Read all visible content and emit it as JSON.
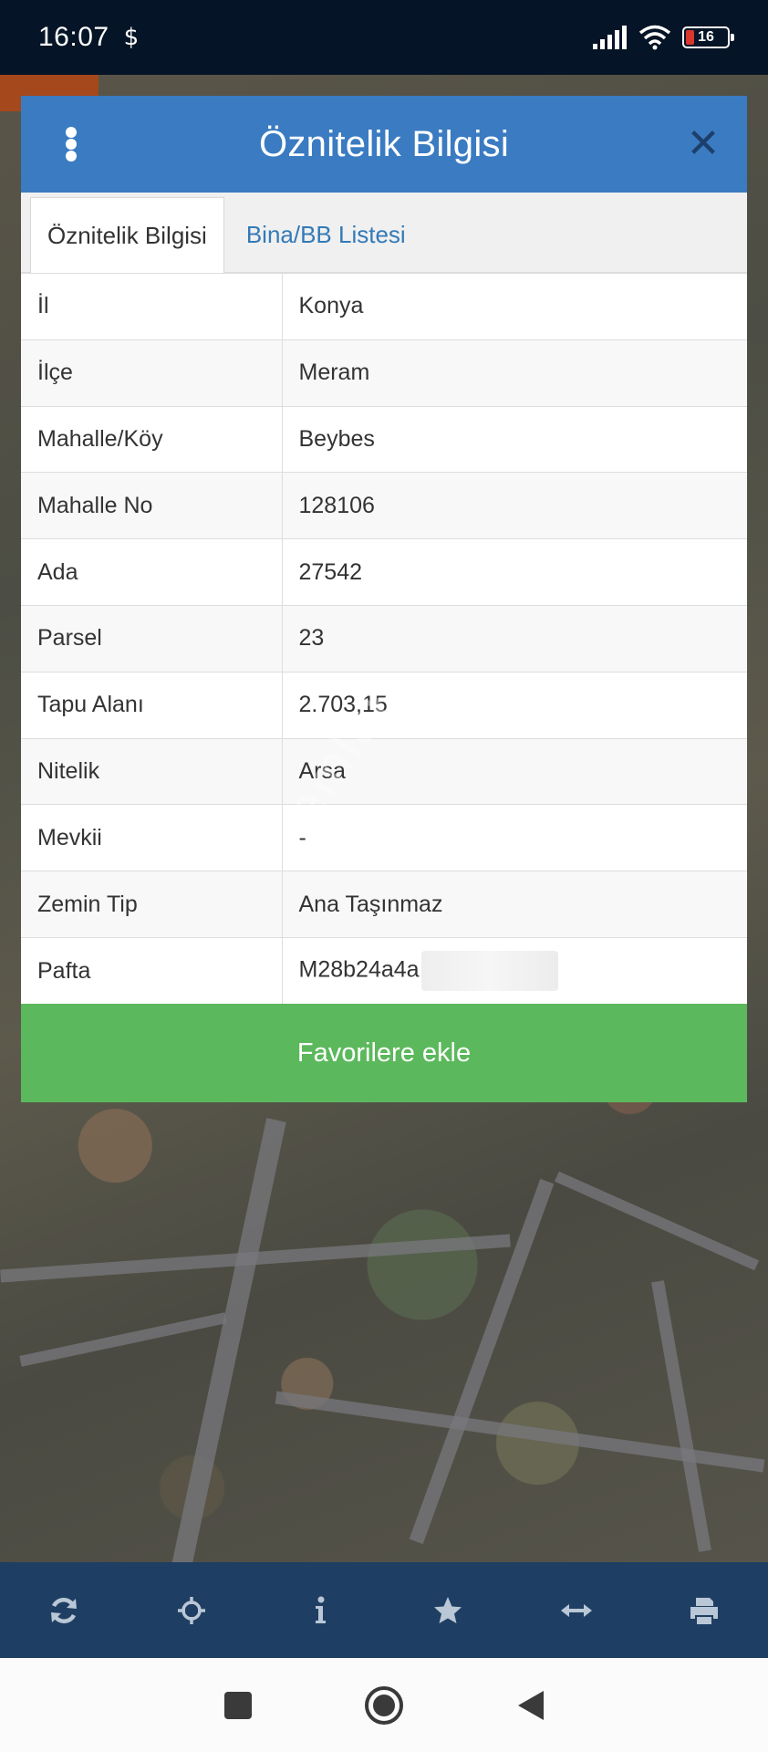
{
  "status_bar": {
    "time": "16:07",
    "currency_icon": "$",
    "battery_level": "16",
    "icons": [
      "signal-icon",
      "wifi-icon",
      "battery-icon"
    ]
  },
  "dialog": {
    "title": "Öznitelik Bilgisi",
    "tabs": [
      {
        "label": "Öznitelik Bilgisi",
        "active": true
      },
      {
        "label": "Bina/BB Listesi",
        "active": false
      }
    ],
    "rows": [
      {
        "key": "İl",
        "value": "Konya"
      },
      {
        "key": "İlçe",
        "value": "Meram"
      },
      {
        "key": "Mahalle/Köy",
        "value": "Beybes"
      },
      {
        "key": "Mahalle No",
        "value": "128106"
      },
      {
        "key": "Ada",
        "value": "27542"
      },
      {
        "key": "Parsel",
        "value": "23"
      },
      {
        "key": "Tapu Alanı",
        "value": "2.703,15"
      },
      {
        "key": "Nitelik",
        "value": "Arsa"
      },
      {
        "key": "Mevkii",
        "value": "-"
      },
      {
        "key": "Zemin Tip",
        "value": "Ana Taşınmaz"
      },
      {
        "key": "Pafta",
        "value": "M28b24a4a"
      }
    ],
    "favorite_button": "Favorilere ekle"
  },
  "toolbar": {
    "buttons": [
      "refresh-icon",
      "locate-icon",
      "info-icon",
      "star-icon",
      "measure-icon",
      "print-icon"
    ]
  },
  "nav": {
    "buttons": [
      "recents-icon",
      "home-icon",
      "back-icon"
    ]
  },
  "colors": {
    "header_blue": "#3a7bc2",
    "favorite_green": "#5cb85c",
    "toolbar_blue": "#1f3e63",
    "tab_link": "#337ab7"
  }
}
